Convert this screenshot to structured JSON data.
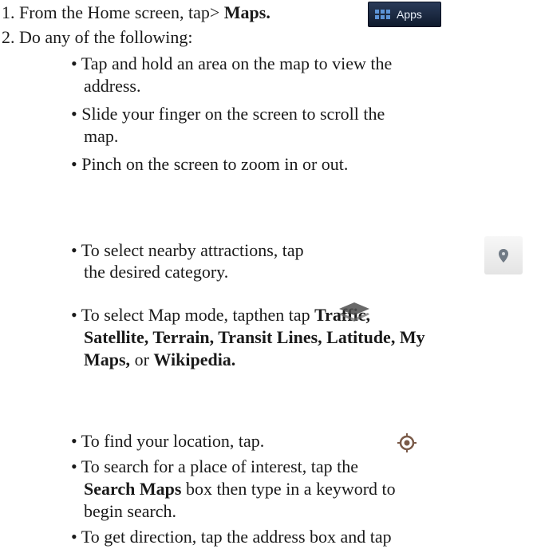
{
  "step1": {
    "prefix": "1. From the Home screen, tap> ",
    "bold": "Maps.",
    "icon_label": "Apps",
    "icon": "apps-grid-icon"
  },
  "step2": {
    "text": "2. Do any of the following:"
  },
  "bullets": {
    "b1_l1": "• Tap and hold an area on the map to view the",
    "b1_l2": "address.",
    "b2_l1": "• Slide your finger on the screen to scroll the",
    "b2_l2": "map.",
    "b3": "• Pinch on the screen to zoom in or out.",
    "b4_l1": "• To select nearby attractions, tap",
    "b4_l2": "the desired category.",
    "b5_l1_pre": "• To select Map mode, tapthen tap ",
    "b5_l1_bold": "Traffic,",
    "b5_l2": "Satellite, Terrain, Transit Lines, Latitude, My",
    "b5_l3_bold1": "Maps,",
    "b5_l3_mid": " or ",
    "b5_l3_bold2": "Wikipedia.",
    "b6": "• To find your location, tap.",
    "b7_l1": "• To search for a place of interest, tap the",
    "b7_l2_bold": "Search Maps",
    "b7_l2_rest": " box then type in a keyword to",
    "b7_l3": "begin search.",
    "b8_l1": "• To get direction, tap the address box and tap"
  },
  "icons": {
    "places": "map-pin-icon",
    "layers": "layers-icon",
    "location": "my-location-icon"
  }
}
